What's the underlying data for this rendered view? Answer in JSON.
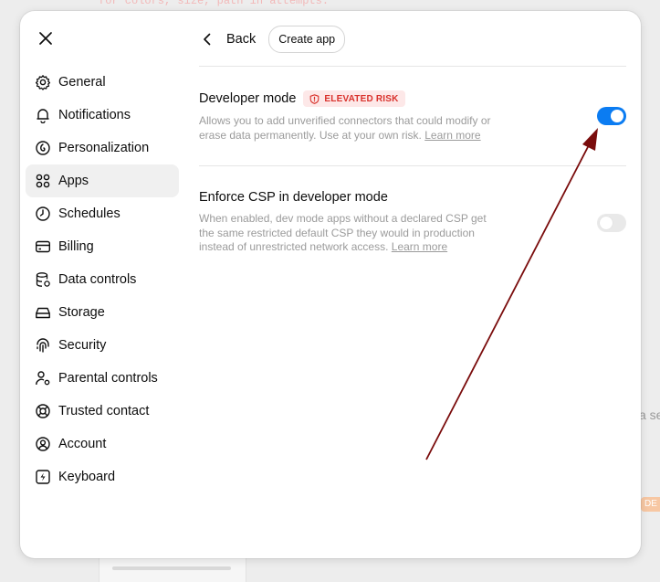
{
  "background": {
    "code_line": "for colors, size, path in attempts:",
    "side_text": "a se",
    "badge": "DE"
  },
  "sidebar": {
    "items": [
      {
        "label": "General",
        "icon": "gear-icon"
      },
      {
        "label": "Notifications",
        "icon": "bell-icon"
      },
      {
        "label": "Personalization",
        "icon": "personalization-icon"
      },
      {
        "label": "Apps",
        "icon": "apps-icon"
      },
      {
        "label": "Schedules",
        "icon": "clock-icon"
      },
      {
        "label": "Billing",
        "icon": "card-icon"
      },
      {
        "label": "Data controls",
        "icon": "database-icon"
      },
      {
        "label": "Storage",
        "icon": "storage-icon"
      },
      {
        "label": "Security",
        "icon": "fingerprint-icon"
      },
      {
        "label": "Parental controls",
        "icon": "parental-icon"
      },
      {
        "label": "Trusted contact",
        "icon": "lifebuoy-icon"
      },
      {
        "label": "Account",
        "icon": "user-circle-icon"
      },
      {
        "label": "Keyboard",
        "icon": "keyboard-icon"
      }
    ],
    "active": "Apps"
  },
  "header": {
    "back_label": "Back",
    "create_app_label": "Create app"
  },
  "settings": {
    "developer_mode": {
      "title": "Developer mode",
      "badge": "ELEVATED RISK",
      "description": "Allows you to add unverified connectors that could modify or erase data permanently. Use at your own risk.",
      "link": "Learn more",
      "enabled": true
    },
    "enforce_csp": {
      "title": "Enforce CSP in developer mode",
      "description": "When enabled, dev mode apps without a declared CSP get the same restricted default CSP they would in production instead of unrestricted network access.",
      "link": "Learn more",
      "enabled": false
    }
  },
  "colors": {
    "accent": "#0b7cf2",
    "danger": "#d9312b",
    "annotation_arrow": "#7a0c0c"
  }
}
